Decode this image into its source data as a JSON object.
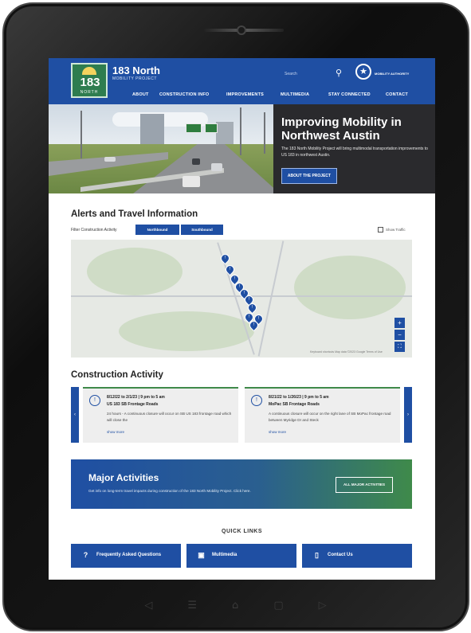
{
  "header": {
    "logo_number": "183",
    "logo_sub": "NORTH",
    "site_title": "183 North",
    "site_subtitle": "MOBILITY PROJECT",
    "search_placeholder": "Search",
    "authority_label": "MOBILITY AUTHORITY",
    "icons": {
      "search": "search-icon",
      "authority": "star-icon"
    }
  },
  "menu": [
    {
      "label": "ABOUT"
    },
    {
      "label": "CONSTRUCTION INFO"
    },
    {
      "label": "IMPROVEMENTS"
    },
    {
      "label": "MULTIMEDIA"
    },
    {
      "label": "STAY CONNECTED"
    },
    {
      "label": "CONTACT"
    }
  ],
  "hero": {
    "title": "Improving Mobility in Northwest Austin",
    "text": "The 183 North Mobility Project will bring multimodal transportation improvements to US 183 in northwest Austin.",
    "button": "ABOUT THE PROJECT"
  },
  "alerts": {
    "title": "Alerts and Travel Information",
    "filter_label": "Filter Construction Activity",
    "northbound": "Northbound",
    "southbound": "Southbound",
    "show_traffic": "Show Traffic",
    "map_credit": "Keyboard shortcuts   Map data ©2023 Google   Terms of Use"
  },
  "construction": {
    "title": "Construction Activity",
    "cards": [
      {
        "date": "8/12/22 to 2/1/23 | 9 pm to 5 am",
        "road": "US 183 SB Frontage Roads",
        "desc": "24 hours - A continuous closure will occur on SB US 183 frontage road which will close the",
        "more": "show more"
      },
      {
        "date": "8/21/22 to 1/26/23 | 9 pm to 5 am",
        "road": "MoPac SB Frontage Roads",
        "desc": "A continuous closure will occur on the right lane of SB MoPac frontage road between Myridge Dr and Steck",
        "more": "show more"
      }
    ]
  },
  "major": {
    "title": "Major Activities",
    "text": "Get info on long-term travel impacts during construction of the 183 North Mobility Project. Click here.",
    "button": "ALL MAJOR ACTIVITIES"
  },
  "quick_links": {
    "title": "QUICK LINKS",
    "items": [
      {
        "label": "Frequently Asked Questions",
        "icon": "question-icon"
      },
      {
        "label": "Multimedia",
        "icon": "media-icon"
      },
      {
        "label": "Contact Us",
        "icon": "phone-icon"
      }
    ]
  },
  "colors": {
    "primary": "#1f4fa3",
    "accent_green": "#3f8a4a",
    "dark_panel": "#2a2a2d"
  }
}
